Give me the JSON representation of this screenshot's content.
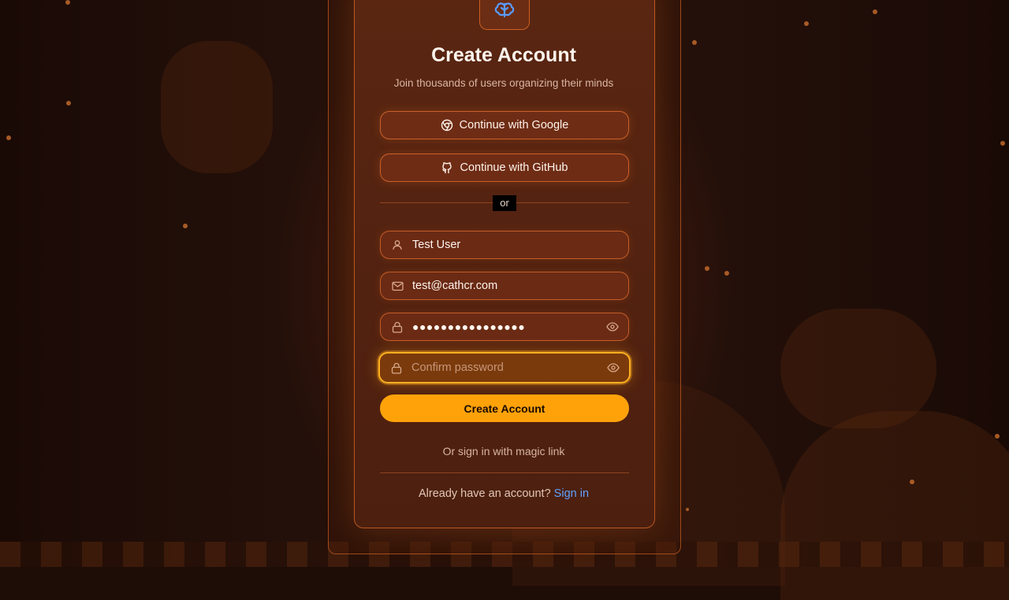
{
  "header": {
    "title": "Create Account",
    "subtitle": "Join thousands of users organizing their minds"
  },
  "oauth": {
    "google_label": "Continue with Google",
    "github_label": "Continue with GitHub"
  },
  "divider": {
    "label": "or"
  },
  "form": {
    "name_value": "Test User",
    "email_value": "test@cathcr.com",
    "password_value": "●●●●●●●●●●●●●●●●",
    "confirm_placeholder": "Confirm password",
    "submit_label": "Create Account"
  },
  "footer": {
    "magic_link_label": "Or sign in with magic link",
    "have_account_text": "Already have an account?",
    "sign_in_label": "Sign in"
  },
  "colors": {
    "accent": "#ffa20a",
    "link": "#5ea2ff",
    "card_border": "#e06e2d",
    "logo_icon": "#5a9cff"
  },
  "icons": {
    "logo": "brain-icon",
    "google": "chrome-icon",
    "github": "github-icon",
    "name": "user-icon",
    "email": "mail-icon",
    "password": "lock-icon",
    "toggle": "eye-icon"
  }
}
